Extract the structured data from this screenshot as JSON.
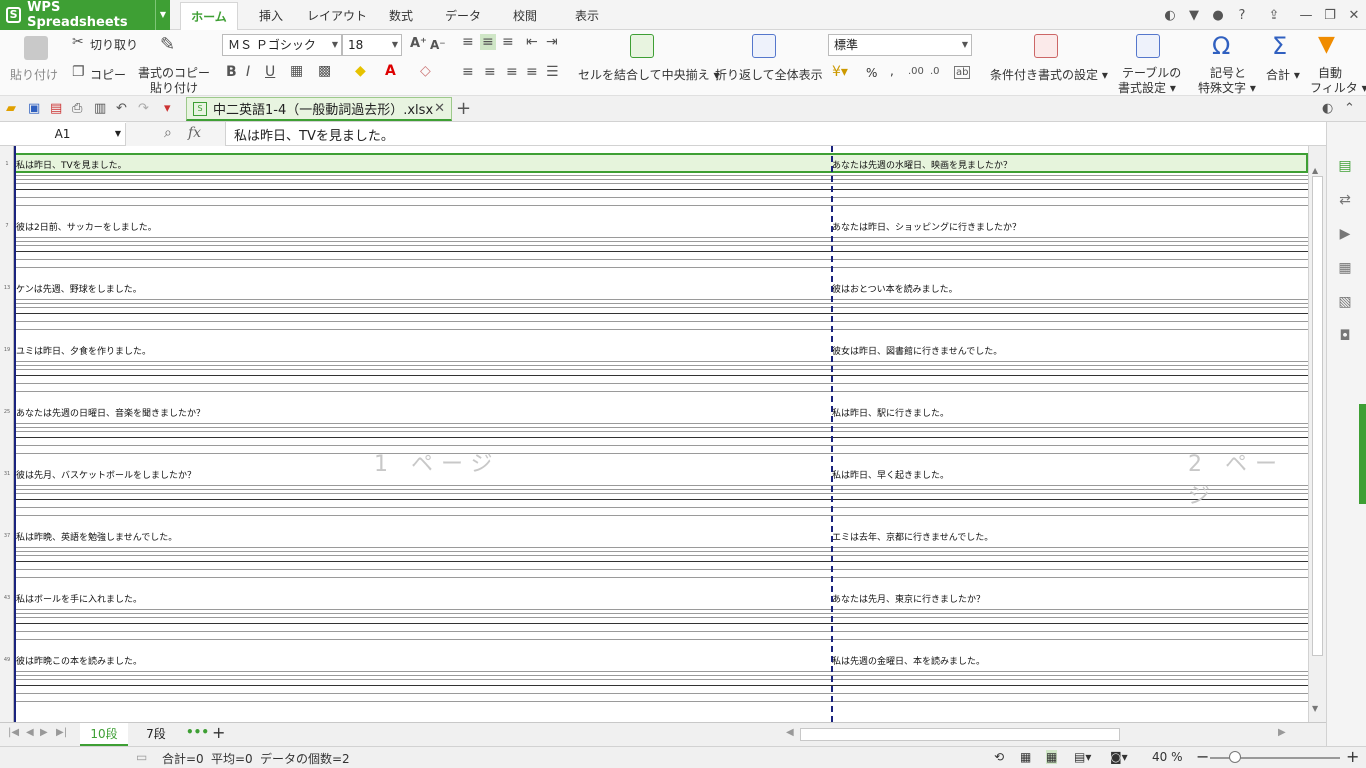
{
  "app": {
    "name": "WPS Spreadsheets",
    "logo_letter": "S"
  },
  "menu": {
    "tabs": [
      "ホーム",
      "挿入",
      "レイアウト",
      "数式",
      "データ",
      "校閲",
      "表示"
    ],
    "active_index": 0
  },
  "ribbon": {
    "paste": "貼り付け",
    "cut": "切り取り",
    "copy": "コピー",
    "format_painter_1": "書式のコピー",
    "format_painter_2": "貼り付け",
    "font_name": "ＭＳ Ｐゴシック",
    "font_size": "18",
    "merge_center": "セルを結合して中央揃え",
    "wrap_text": "折り返して全体表示",
    "number_format": "標準",
    "percent": "%",
    "comma": ",",
    "conditional_format": "条件付き書式の設定",
    "table_style_1": "テーブルの",
    "table_style_2": "書式設定",
    "symbol_1": "記号と",
    "symbol_2": "特殊文字",
    "sum": "合計",
    "filter_1": "自動",
    "filter_2": "フィルタ"
  },
  "file": {
    "name": "中二英語1-4（一般動詞過去形）.xlsx"
  },
  "formula_bar": {
    "cell_ref": "A1",
    "fx": "fx",
    "content": "私は昨日、TVを見ました。"
  },
  "sheet": {
    "page_labels": [
      "1 ページ",
      "2 ページ"
    ],
    "blocks": [
      {
        "row": "1",
        "left": "私は昨日、TVを見ました。",
        "right": "あなたは先週の水曜日、映画を見ましたか？"
      },
      {
        "row": "7",
        "left": "彼は2日前、サッカーをしました。",
        "right": "あなたは昨日、ショッピングに行きましたか？"
      },
      {
        "row": "13",
        "left": "ケンは先週、野球をしました。",
        "right": "彼はおとつい本を読みました。"
      },
      {
        "row": "19",
        "left": "ユミは昨日、夕食を作りました。",
        "right": "彼女は昨日、図書館に行きませんでした。"
      },
      {
        "row": "25",
        "left": "あなたは先週の日曜日、音楽を聞きましたか？",
        "right": "私は昨日、駅に行きました。"
      },
      {
        "row": "31",
        "left": "彼は先月、バスケットボールをしましたか？",
        "right": "私は昨日、早く起きました。"
      },
      {
        "row": "37",
        "left": "私は昨晩、英語を勉強しませんでした。",
        "right": "エミは去年、京都に行きませんでした。"
      },
      {
        "row": "43",
        "left": "私はボールを手に入れました。",
        "right": "あなたは先月、東京に行きましたか？"
      },
      {
        "row": "49",
        "left": "彼は昨晩この本を読みました。",
        "right": "私は先週の金曜日、本を読みました。"
      }
    ]
  },
  "sheet_tabs": {
    "tabs": [
      "10段",
      "7段"
    ],
    "active_index": 0,
    "more": "•••",
    "add": "+"
  },
  "status": {
    "sum": "合計=0",
    "avg": "平均=0",
    "count": "データの個数=2",
    "zoom": "40 %"
  },
  "colors": {
    "accent": "#3e9f34",
    "page_border": "#1a237e"
  }
}
